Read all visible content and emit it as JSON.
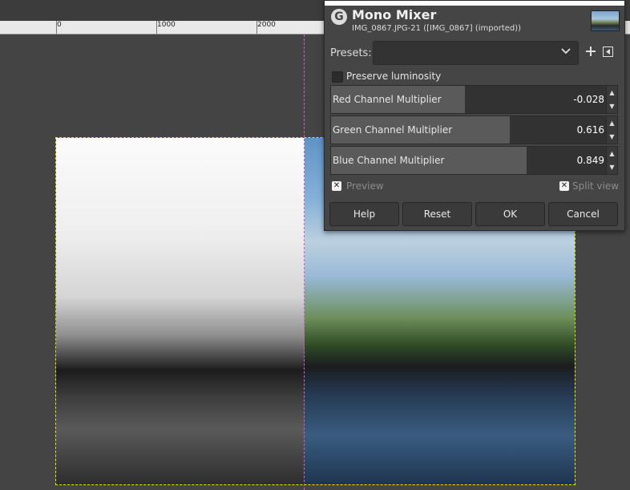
{
  "ruler": {
    "marks": [
      "0",
      "1000",
      "2000"
    ]
  },
  "dialog": {
    "app_glyph": "G",
    "title": "Mono Mixer",
    "subtitle": "IMG_0867.JPG-21 ([IMG_0867] (imported))",
    "presets": {
      "label": "Presets:",
      "value": ""
    },
    "preserve_luminosity": {
      "label": "Preserve luminosity",
      "checked": false
    },
    "sliders": [
      {
        "name": "Red Channel Multiplier",
        "value": "-0.028",
        "fraction": 0.47
      },
      {
        "name": "Green Channel Multiplier",
        "value": "0.616",
        "fraction": 0.63
      },
      {
        "name": "Blue Channel Multiplier",
        "value": "0.849",
        "fraction": 0.69
      }
    ],
    "preview": {
      "label": "Preview",
      "checked": true
    },
    "split_view": {
      "label": "Split view",
      "checked": true
    },
    "buttons": {
      "help": "Help",
      "reset": "Reset",
      "ok": "OK",
      "cancel": "Cancel"
    }
  },
  "colors": {
    "guide": "#d05ad0",
    "selection": "#e6e600",
    "panel": "#454545"
  }
}
